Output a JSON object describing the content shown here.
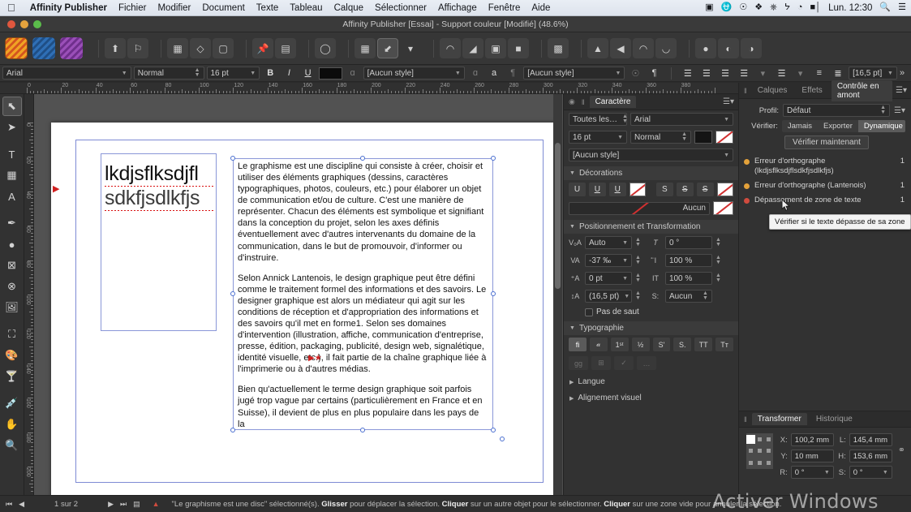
{
  "menubar": {
    "apple": "",
    "items": [
      "Affinity Publisher",
      "Fichier",
      "Modifier",
      "Document",
      "Texte",
      "Tableau",
      "Calque",
      "Sélectionner",
      "Affichage",
      "Fenêtre",
      "Aide"
    ],
    "status_icons": [
      "screen-record-icon",
      "creative-cloud-icon",
      "app-icon",
      "dropbox-icon",
      "bluetooth-icon",
      "wifi-icon",
      "battery-icon"
    ],
    "clock": "Lun. 12:30",
    "search_icon": "search-icon",
    "control_center_icon": "control-center-icon"
  },
  "window": {
    "title": "Affinity Publisher [Essai] - Support couleur [Modifié] (48.6%)"
  },
  "toolbar": {
    "personas": [
      "publisher-persona",
      "designer-persona",
      "photo-persona"
    ],
    "buttons": [
      "open-document",
      "add-pages",
      "frame-text-tool",
      "picture-frame",
      "artistic-text",
      "pin-tool",
      "layout-tool",
      "lasso-tool",
      "grid-toggle",
      "snapping-magnet",
      "snapping-options",
      "move-forward",
      "move-backward",
      "group",
      "ungroup",
      "align-left",
      "flip-horizontal",
      "flip-vertical",
      "rotate-left",
      "rotate-right",
      "boolean-add",
      "boolean-subtract",
      "boolean-intersect"
    ],
    "expand_icon": "chevron-double-right"
  },
  "text_context": {
    "font_family": "Arial",
    "font_style": "Normal",
    "font_size": "16 pt",
    "bold": "B",
    "italic": "I",
    "underline": "U",
    "color_hex": "#0b0b0b",
    "char_style": "[Aucun style]",
    "para_style": "[Aucun style]",
    "leading": "[16,5 pt]",
    "pilcrow": "¶"
  },
  "rulers": {
    "unit": "mm",
    "h_labels": [
      "0",
      "20",
      "40",
      "60",
      "80",
      "100",
      "120",
      "140",
      "160",
      "180",
      "200",
      "220",
      "240",
      "260",
      "280",
      "300",
      "320",
      "340",
      "360",
      "380"
    ],
    "v_labels": [
      "0",
      "20",
      "40",
      "60",
      "80",
      "100",
      "120",
      "140",
      "160",
      "180",
      "200"
    ]
  },
  "tools": [
    {
      "name": "move-tool",
      "glyph": "⬉",
      "selected": true
    },
    {
      "name": "node-tool",
      "glyph": "➤",
      "selected": false
    },
    {
      "name": "frame-text-tool",
      "glyph": "T",
      "selected": false
    },
    {
      "name": "table-tool",
      "glyph": "▦",
      "selected": false
    },
    {
      "name": "artistic-text-tool",
      "glyph": "A",
      "selected": false
    },
    {
      "name": "pen-tool",
      "glyph": "✒",
      "selected": false
    },
    {
      "name": "shape-tool",
      "glyph": "●",
      "selected": false
    },
    {
      "name": "picture-frame-tool",
      "glyph": "⊠",
      "selected": false
    },
    {
      "name": "ellipse-frame-tool",
      "glyph": "⊗",
      "selected": false
    },
    {
      "name": "place-image-tool",
      "glyph": "🖼",
      "selected": false
    },
    {
      "name": "crop-tool",
      "glyph": "⛶",
      "selected": false
    },
    {
      "name": "colour-picker-palette",
      "glyph": "🎨",
      "selected": false
    },
    {
      "name": "fill-tool",
      "glyph": "🍸",
      "selected": false
    },
    {
      "name": "eyedropper-tool",
      "glyph": "💉",
      "selected": false
    },
    {
      "name": "hand-tool",
      "glyph": "✋",
      "selected": false
    },
    {
      "name": "zoom-tool",
      "glyph": "🔍",
      "selected": false
    }
  ],
  "document": {
    "left_box": {
      "line1": "lkdjsflksdjfl",
      "line2": "sdkfjsdlkfjs"
    },
    "paragraphs": [
      "Le graphisme est une discipline qui consiste à créer, choisir et utiliser des éléments graphiques (dessins, caractères typographiques, photos, couleurs, etc.) pour élaborer un objet de communication et/ou de culture. C'est une manière de représenter. Chacun des éléments est symbolique et signifiant dans la conception du projet, selon les axes définis éventuellement avec d'autres intervenants du domaine de la communication, dans le but de promouvoir, d'informer ou d'instruire.",
      "Selon Annick Lantenois, le design graphique peut être défini comme le traitement formel des informations et des savoirs. Le designer graphique est alors un médiateur qui agit sur les conditions de réception et d'appropriation des informations et des savoirs qu'il met en forme1. Selon ses domaines d'intervention (illustration, affiche, communication d'entreprise, presse, édition, packaging, publicité, design web, signalétique, identité visuelle, etc.), il fait partie de la chaîne graphique liée à l'imprimerie ou à d'autres médias.",
      "Bien qu'actuellement le terme design graphique soit parfois jugé trop vague par certains (particulièrement en France et en Suisse), il devient de plus en plus populaire dans les pays de la"
    ]
  },
  "character_panel": {
    "tabs": [
      {
        "label": "Caractère",
        "active": true
      }
    ],
    "menu_icon": "panel-menu-icon",
    "scope": "Toutes les…",
    "font_family": "Arial",
    "font_size": "16 pt",
    "font_style": "Normal",
    "text_style": "[Aucun style]",
    "fill_hex": "#141414",
    "decorations": {
      "title": "Décorations",
      "underline_buttons": [
        "U",
        "U",
        "U"
      ],
      "strike_buttons": [
        "S",
        "S",
        "S"
      ],
      "line_style": "Aucun"
    },
    "positioning": {
      "title": "Positionnement et Transformation",
      "kerning": "Auto",
      "tracking": "-37 ‰",
      "baseline": "0 pt",
      "leading": "(16,5 pt)",
      "skew": "0 °",
      "vertical_scale": "100 %",
      "horizontal_scale": "100 %",
      "position": "Aucun",
      "no_break": "Pas de saut"
    },
    "typography": {
      "title": "Typographie",
      "buttons": [
        "fi",
        "𝒶",
        "1ˢᵗ",
        "½",
        "S'",
        "S.",
        "TT",
        "Tт"
      ],
      "buttons_row2": [
        "gg",
        "⊞",
        "✓",
        "…"
      ]
    },
    "language": "Langue",
    "optical_alignment": "Alignement visuel"
  },
  "preflight_panel": {
    "tabs": [
      {
        "label": "Calques",
        "active": false
      },
      {
        "label": "Effets",
        "active": false
      },
      {
        "label": "Contrôle en amont",
        "active": true
      }
    ],
    "menu_icon": "panel-menu-icon",
    "profile_label": "Profil:",
    "profile_value": "Défaut",
    "profile_menu_icon": "profile-menu-icon",
    "check_label": "Vérifier:",
    "check_options": [
      {
        "label": "Jamais",
        "active": false
      },
      {
        "label": "Exporter",
        "active": false
      },
      {
        "label": "Dynamique",
        "active": true
      }
    ],
    "check_now_button": "Vérifier maintenant",
    "errors": [
      {
        "text": "Erreur d'orthographe (lkdjsflksdjflsdkfjsdlkfjs)",
        "count": "1",
        "color": "#e3a13a"
      },
      {
        "text": "Erreur d'orthographe (Lantenois)",
        "count": "1",
        "color": "#e3a13a"
      },
      {
        "text": "Dépassement de zone de texte",
        "count": "1",
        "color": "#d04b3e"
      }
    ],
    "tooltip": "Vérifier si le texte dépasse de sa zone"
  },
  "transform_panel": {
    "tabs": [
      {
        "label": "Transformer",
        "active": true
      },
      {
        "label": "Historique",
        "active": false
      }
    ],
    "x_label": "X:",
    "x_value": "100,2 mm",
    "y_label": "Y:",
    "y_value": "10 mm",
    "w_label": "L:",
    "w_value": "145,4 mm",
    "h_label": "H:",
    "h_value": "153,6 mm",
    "r_label": "R:",
    "r_value": "0 °",
    "s_label": "S:",
    "s_value": "0 °",
    "link_icon": "link-ratio-icon"
  },
  "statusbar": {
    "first_page_icon": "first-page-icon",
    "prev_page_icon": "prev-page-icon",
    "page_indicator": "1 sur 2",
    "next_page_icon": "next-page-icon",
    "last_page_icon": "last-page-icon",
    "pages_icon": "pages-icon",
    "warning_icon": "warning-icon",
    "hint_parts": [
      {
        "text": "\"Le graphisme est une disc\" sélectionné(s). ",
        "bold": false
      },
      {
        "text": "Glisser",
        "bold": true
      },
      {
        "text": " pour déplacer la sélection. ",
        "bold": false
      },
      {
        "text": "Cliquer",
        "bold": true
      },
      {
        "text": " sur un autre objet pour le sélectionner. ",
        "bold": false
      },
      {
        "text": "Cliquer",
        "bold": true
      },
      {
        "text": " sur une zone vide pour annuler la sélection.",
        "bold": false
      }
    ]
  },
  "watermark": "Activer Windows"
}
